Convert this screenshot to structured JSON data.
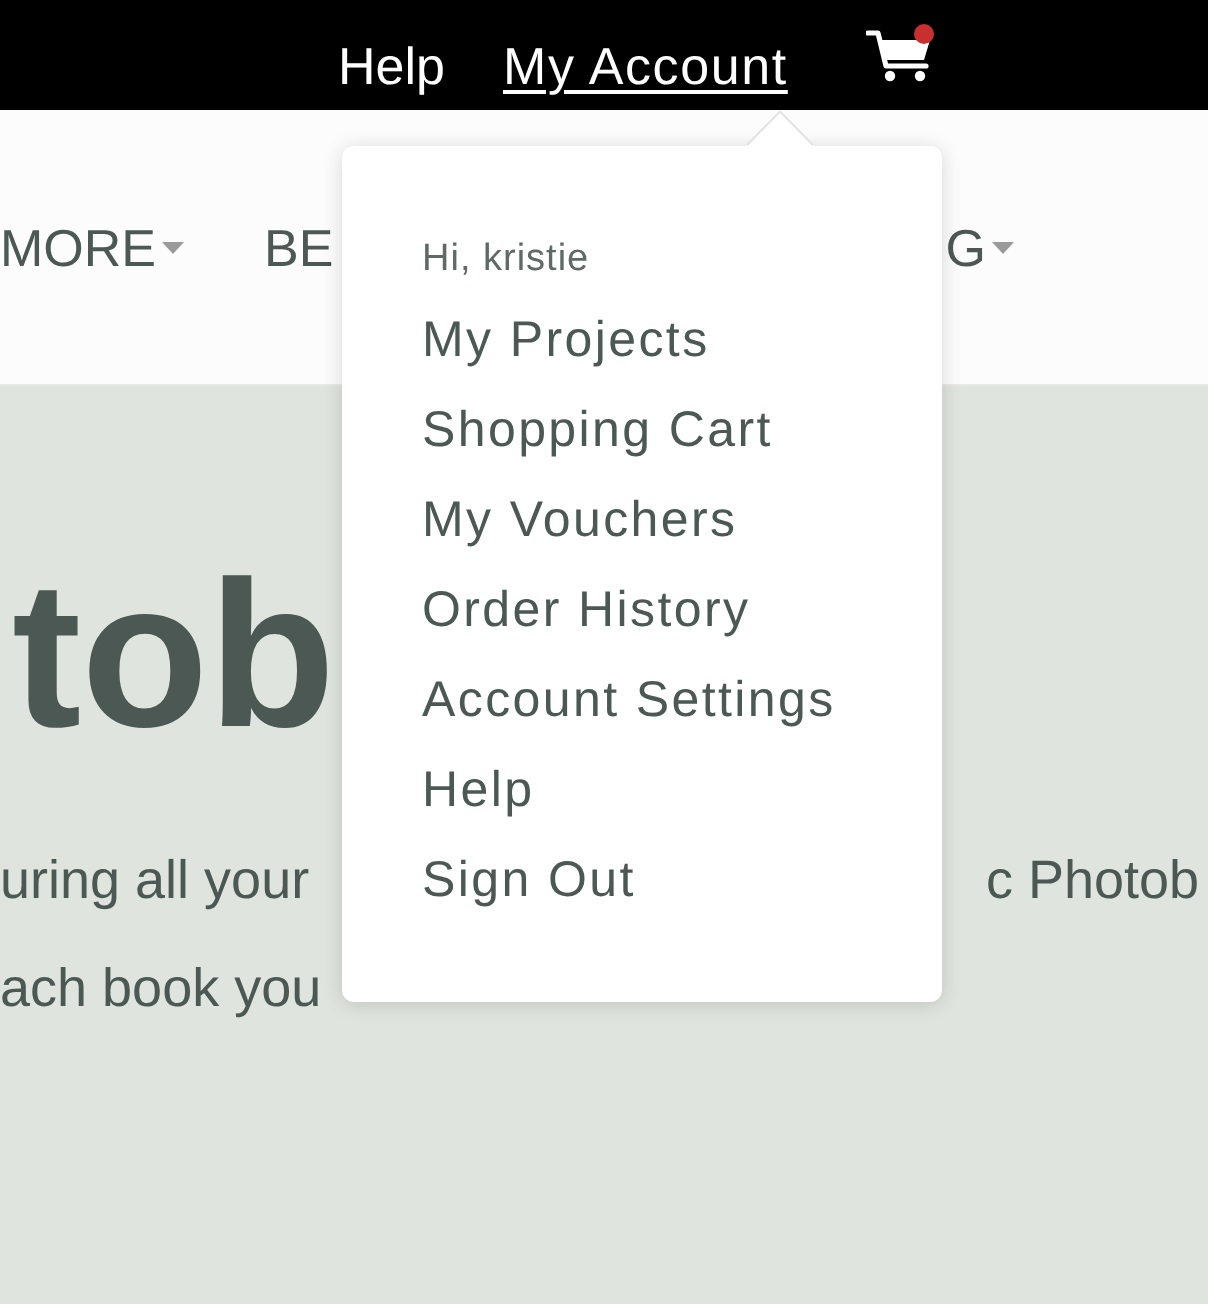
{
  "top_bar": {
    "links": [
      {
        "label": "Help",
        "selected": false
      },
      {
        "label": "My Account",
        "selected": true
      }
    ],
    "cart": {
      "has_items": true
    }
  },
  "nav": {
    "items": [
      {
        "label": "MORE",
        "dropdown": true
      },
      {
        "label": "BE",
        "dropdown": false
      },
      {
        "label": "G",
        "dropdown": true
      }
    ]
  },
  "hero": {
    "heading": "tob",
    "lines": [
      {
        "left": "uring all your",
        "right": "c Photob"
      },
      {
        "left": "ach book you"
      }
    ]
  },
  "account_menu": {
    "greeting": "Hi, kristie",
    "items": [
      "My Projects",
      "Shopping Cart",
      "My Vouchers",
      "Order History",
      "Account Settings",
      "Help",
      "Sign Out"
    ]
  }
}
